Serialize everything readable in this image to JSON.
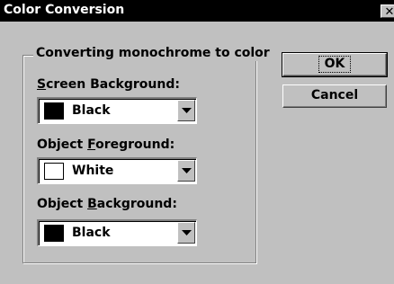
{
  "window": {
    "title": "Color Conversion",
    "close_glyph": "✕"
  },
  "group": {
    "label": "Converting monochrome to color"
  },
  "fields": [
    {
      "label_mnemonic": "S",
      "label_rest": "creen Background:",
      "value": "Black",
      "swatch_color": "#000000"
    },
    {
      "label_prefix": "Object ",
      "label_mnemonic": "F",
      "label_rest": "oreground:",
      "value": "White",
      "swatch_color": "#ffffff"
    },
    {
      "label_prefix": "Object ",
      "label_mnemonic": "B",
      "label_rest": "ackground:",
      "value": "Black",
      "swatch_color": "#000000"
    }
  ],
  "buttons": {
    "ok_label": "OK",
    "cancel_label": "Cancel"
  }
}
